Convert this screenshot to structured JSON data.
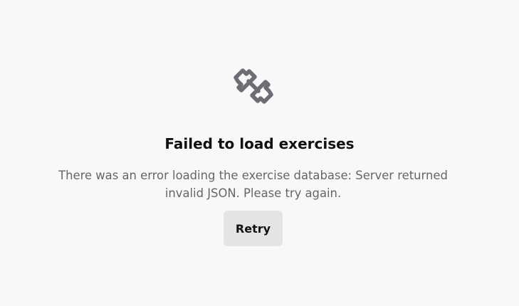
{
  "error": {
    "icon": "dumbbell-icon",
    "icon_color": "#6d6d74",
    "title": "Failed to load exercises",
    "message": "There was an error loading the exercise database: Server returned invalid JSON. Please try again.",
    "retry_label": "Retry"
  },
  "colors": {
    "background": "#f8f8f9",
    "title": "#111111",
    "message": "#666668",
    "button_background": "#e4e4e7"
  }
}
